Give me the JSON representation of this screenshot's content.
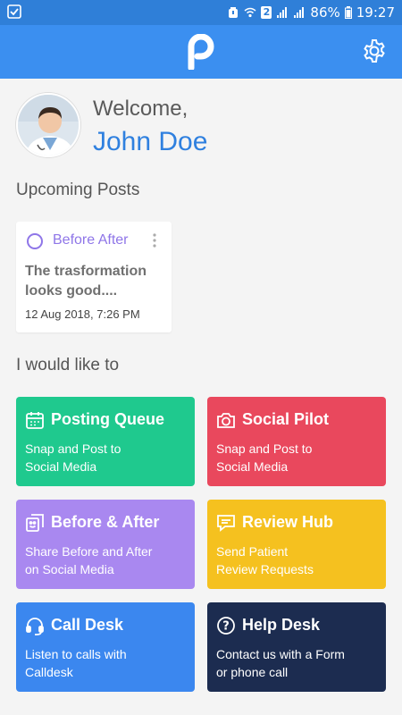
{
  "status_bar": {
    "battery": "86%",
    "time": "19:27",
    "sim": "2"
  },
  "header": {
    "logo_icon": "p-logo",
    "settings_icon": "gear-icon"
  },
  "welcome": {
    "greeting": "Welcome,",
    "name": "John Doe"
  },
  "upcoming": {
    "title": "Upcoming Posts",
    "posts": [
      {
        "title": "Before After",
        "text": "The trasformation looks good....",
        "date": "12 Aug 2018, 7:26 PM"
      }
    ]
  },
  "actions": {
    "title": "I would like to",
    "tiles": [
      {
        "title": "Posting Queue",
        "desc_lines": [
          "Snap and Post to",
          "Social Media"
        ],
        "icon": "calendar-icon",
        "color": "#1fc98e"
      },
      {
        "title": "Social Pilot",
        "desc_lines": [
          "Snap and Post to",
          "Social Media"
        ],
        "icon": "camera-icon",
        "color": "#e9485d"
      },
      {
        "title": "Before & After",
        "desc_lines": [
          "Share Before and After",
          "on Social Media"
        ],
        "icon": "photos-icon",
        "color": "#a988f0"
      },
      {
        "title": "Review Hub",
        "desc_lines": [
          "Send Patient",
          "Review Requests"
        ],
        "icon": "chat-icon",
        "color": "#f5c11f"
      },
      {
        "title": "Call Desk",
        "desc_lines": [
          "Listen to calls with",
          "Calldesk"
        ],
        "icon": "headset-icon",
        "color": "#3b87ef"
      },
      {
        "title": "Help Desk",
        "desc_lines": [
          "Contact us with a Form",
          "or phone call"
        ],
        "icon": "help-icon",
        "color": "#1c2c50"
      }
    ]
  }
}
